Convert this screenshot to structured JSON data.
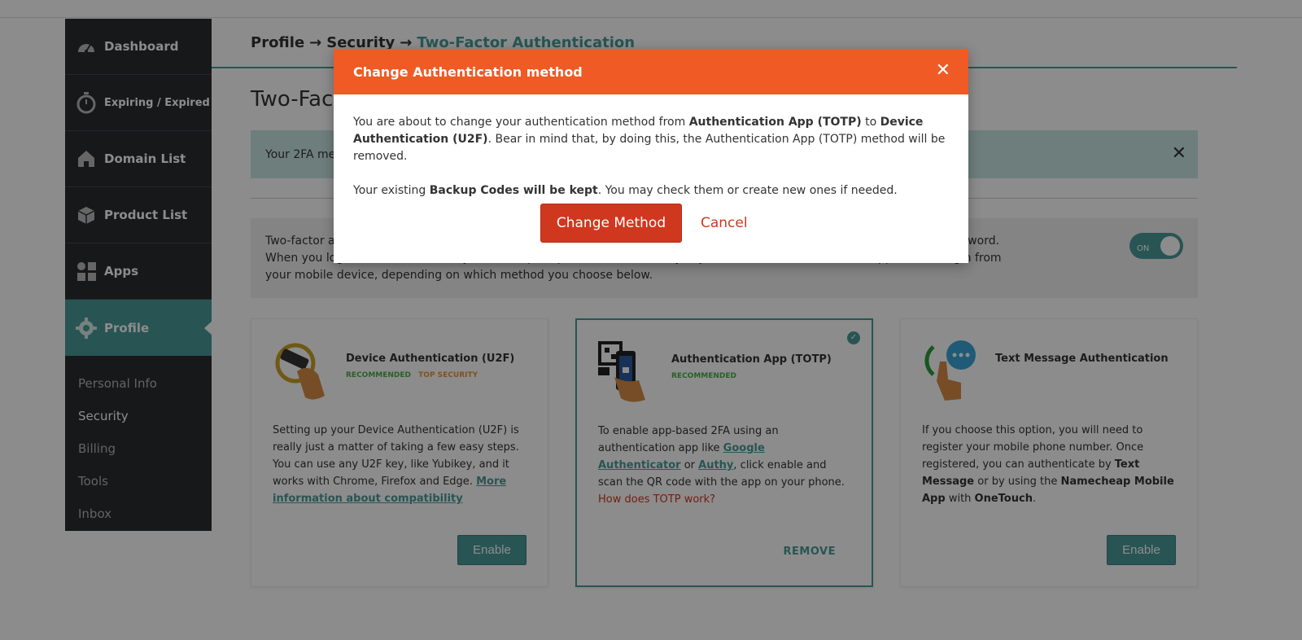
{
  "sidebar": {
    "items": [
      {
        "label": "Dashboard",
        "icon": "speedometer-icon"
      },
      {
        "label": "Expiring / Expired",
        "icon": "stopwatch-icon"
      },
      {
        "label": "Domain List",
        "icon": "home-icon"
      },
      {
        "label": "Product List",
        "icon": "box-icon"
      },
      {
        "label": "Apps",
        "icon": "apps-grid-icon"
      },
      {
        "label": "Profile",
        "icon": "gear-icon"
      }
    ],
    "subitems": [
      "Personal Info",
      "Security",
      "Billing",
      "Tools",
      "Inbox"
    ]
  },
  "breadcrumb": {
    "parts": [
      "Profile",
      "Security",
      "Two-Factor Authentication"
    ],
    "arrow": "→"
  },
  "page": {
    "title": "Two-Factor Authentication",
    "banner": "Your 2FA method has been updated.",
    "intro": "Two-factor authentication adds an extra layer of security to your account by requiring more than just a username and password. When you login with 2FA enabled, you will be prompted to use a security key, enter a verification code or approve the login from your mobile device, depending on which method you choose below.",
    "toggle_label": "ON"
  },
  "cards": [
    {
      "title": "Device Authentication (U2F)",
      "badge_recommended": "RECOMMENDED",
      "badge_top": "TOP SECURITY",
      "body": "Setting up your Device Authentication (U2F) is really just a matter of taking a few easy steps. You can use any U2F key, like Yubikey, and it works with Chrome, Firefox and Edge.",
      "link": "More information about compatibility",
      "button": "Enable"
    },
    {
      "title": "Authentication App (TOTP)",
      "badge_recommended": "RECOMMENDED",
      "body_1": "To enable app-based 2FA using an authentication app like ",
      "link_1": "Google Authenticator",
      "body_2": " or ",
      "link_2": "Authy",
      "body_3": ", click enable and scan the QR code with the app on your phone.",
      "help_link": "How does TOTP work?",
      "action": "REMOVE"
    },
    {
      "title": "Text Message Authentication",
      "body_1": "If you choose this option, you will need to register your mobile phone number. Once registered, you can authenticate by ",
      "bold_1": "Text Message",
      "body_2": " or by using the ",
      "bold_2": "Namecheap Mobile App",
      "body_3": " with ",
      "bold_3": "OneTouch",
      "body_4": ".",
      "button": "Enable"
    }
  ],
  "modal": {
    "title": "Change Authentication method",
    "p1_a": "You are about to change your authentication method from ",
    "p1_b": "Authentication App (TOTP)",
    "p1_c": " to ",
    "p1_d": "Device Authentication (U2F)",
    "p1_e": ". Bear in mind that, by doing this, the Authentication App (TOTP) method will be removed.",
    "p2_a": "Your existing ",
    "p2_b": "Backup Codes will be kept",
    "p2_c": ". You may check them or create new ones if needed.",
    "confirm": "Change Method",
    "cancel": "Cancel"
  },
  "colors": {
    "accent": "#4a9b98",
    "modal_header": "#f05a24",
    "danger": "#d0371f",
    "sidebar": "#2b2d31"
  }
}
